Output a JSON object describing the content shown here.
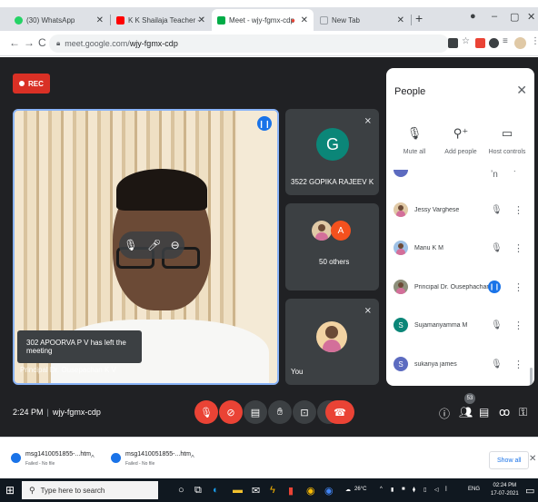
{
  "browser": {
    "tabs": [
      {
        "title": "(30) WhatsApp",
        "color": "#25d366"
      },
      {
        "title": "K K Shailaja Teacher - YouTube",
        "color": "#ff0000"
      },
      {
        "title": "Meet - wjy-fgmx-cdp",
        "color": "#00ac47"
      },
      {
        "title": "New Tab",
        "color": "#9aa0a6"
      }
    ],
    "new_tab_label": "+",
    "url_prefix": "meet.google.com/",
    "url_path": "wjy-fgmx-cdp"
  },
  "meet": {
    "rec_label": "REC",
    "main_tile": {
      "name": "Principal Dr. Ousepachan K V",
      "toast": "302 APOORVA P V has left the meeting"
    },
    "tiles": [
      {
        "name": "3522 GOPIKA RAJEEV K",
        "initial": "G",
        "avatar_color": "#0b8678"
      },
      {
        "name": "50 others",
        "initial": "A",
        "avatar_color": "#f4511e"
      },
      {
        "name": "You"
      }
    ],
    "clock": "2:24 PM",
    "meeting_code": "wjy-fgmx-cdp",
    "participant_count": "53"
  },
  "people_panel": {
    "title": "People",
    "actions": [
      {
        "label": "Mute all",
        "icon": "mute-all-icon"
      },
      {
        "label": "Add people",
        "icon": "add-person-icon"
      },
      {
        "label": "Host controls",
        "icon": "host-controls-icon"
      }
    ],
    "rows": [
      {
        "name": "Jessy Varghese",
        "initial": "",
        "color": "#c5a782",
        "speaking": false
      },
      {
        "name": "Manu K M",
        "initial": "",
        "color": "#3b6ea5",
        "speaking": false
      },
      {
        "name": "Principal Dr. Ousephachan ...",
        "initial": "",
        "color": "#6b4a36",
        "speaking": true
      },
      {
        "name": "Sujamariyamma M",
        "initial": "S",
        "color": "#0b8678",
        "speaking": false
      },
      {
        "name": "sukanya james",
        "initial": "S",
        "color": "#5c6bc0",
        "speaking": false
      }
    ]
  },
  "downloads": {
    "items": [
      {
        "name": "msg1410051855-...htm",
        "status": "Failed - No file"
      },
      {
        "name": "msg1410051855-...htm",
        "status": "Failed - No file"
      }
    ],
    "show_all": "Show all"
  },
  "taskbar": {
    "search_placeholder": "Type here to search",
    "weather": "26°C",
    "lang": "ENG",
    "time": "02:24 PM",
    "date": "17-07-2021"
  }
}
